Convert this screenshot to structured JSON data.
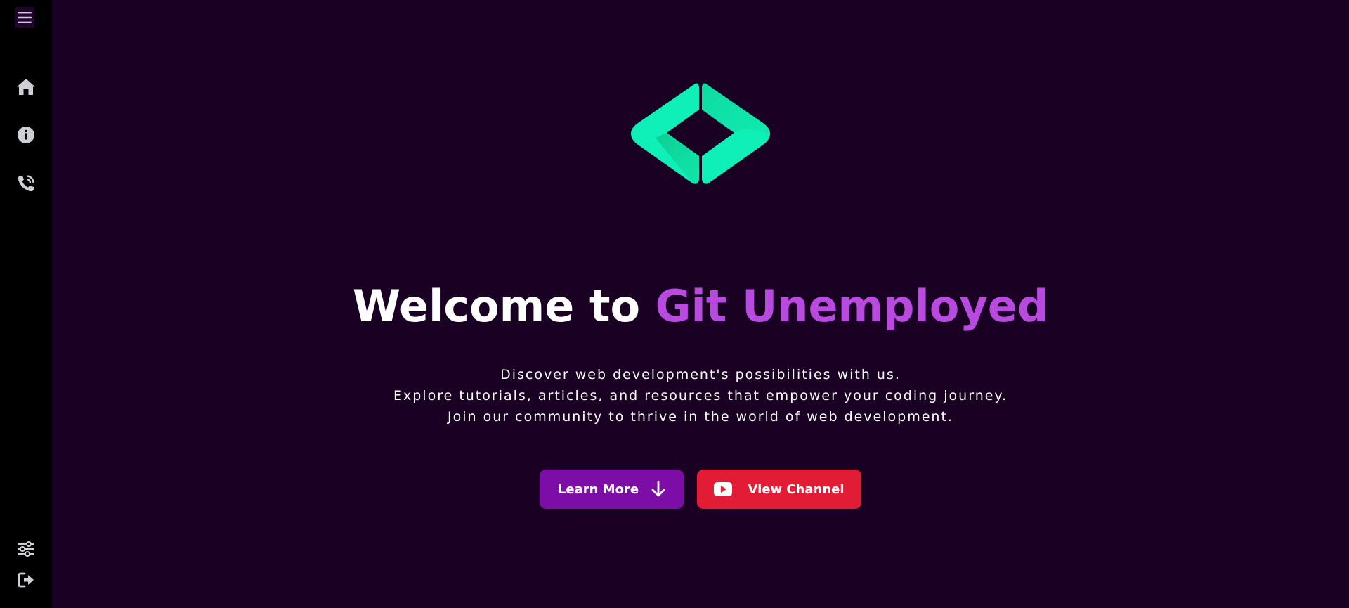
{
  "sidebar": {
    "menu_icon": "hamburger-menu-icon",
    "items": [
      {
        "icon": "home-icon"
      },
      {
        "icon": "info-icon"
      },
      {
        "icon": "phone-icon"
      }
    ],
    "bottom_items": [
      {
        "icon": "settings-sliders-icon"
      },
      {
        "icon": "logout-icon"
      }
    ]
  },
  "hero": {
    "logo": "code-brackets-logo",
    "title_prefix": "Welcome to ",
    "title_accent": "Git Unemployed",
    "description_lines": [
      "Discover web development's possibilities with us.",
      "Explore tutorials, articles, and resources that empower your coding journey.",
      "Join our community to thrive in the world of web development."
    ],
    "learn_more_label": "Learn More",
    "view_channel_label": "View Channel"
  },
  "colors": {
    "background": "#1a0023",
    "sidebar": "#000000",
    "accent_purple": "#b84ae0",
    "logo_green": "#0ff0b8",
    "learn_more_button": "#7c0da6",
    "view_channel_button": "#e31c35"
  }
}
